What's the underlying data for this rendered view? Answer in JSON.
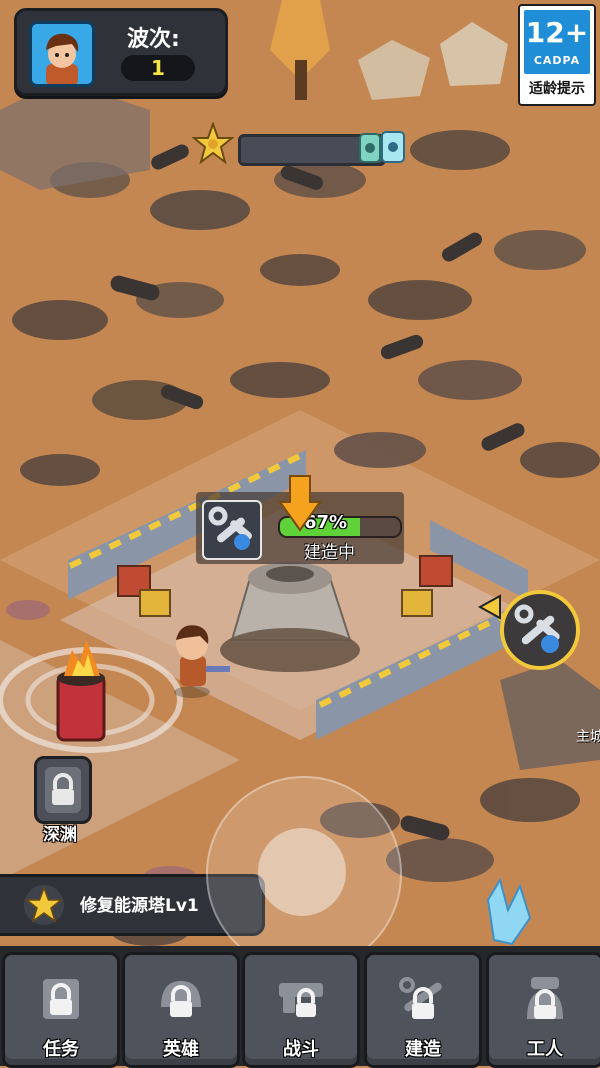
{
  "hud": {
    "wave_label": "波次:",
    "wave_value": "1"
  },
  "age_rating": {
    "number": "12+",
    "org": "CADPA",
    "caption": "适龄提示"
  },
  "build": {
    "progress_percent": 67,
    "progress_text": "67%",
    "status": "建造中"
  },
  "map_labels": {
    "abyss": "深渊",
    "main_partial": "主城"
  },
  "quest": {
    "text": "修复能源塔Lv1"
  },
  "nav": {
    "items": [
      {
        "label": "任务",
        "icon": "lock-scroll-icon",
        "locked": true
      },
      {
        "label": "英雄",
        "icon": "lock-helmet-icon",
        "locked": true
      },
      {
        "label": "战斗",
        "icon": "lock-gun-icon",
        "locked": true
      },
      {
        "label": "建造",
        "icon": "lock-wrench-icon",
        "locked": true
      },
      {
        "label": "工人",
        "icon": "lock-worker-icon",
        "locked": true
      }
    ]
  },
  "colors": {
    "ground": "#c98d5a",
    "accent_yellow": "#f2c93b",
    "progress_green": "#5fd23a",
    "badge_blue": "#1f8ed6"
  }
}
